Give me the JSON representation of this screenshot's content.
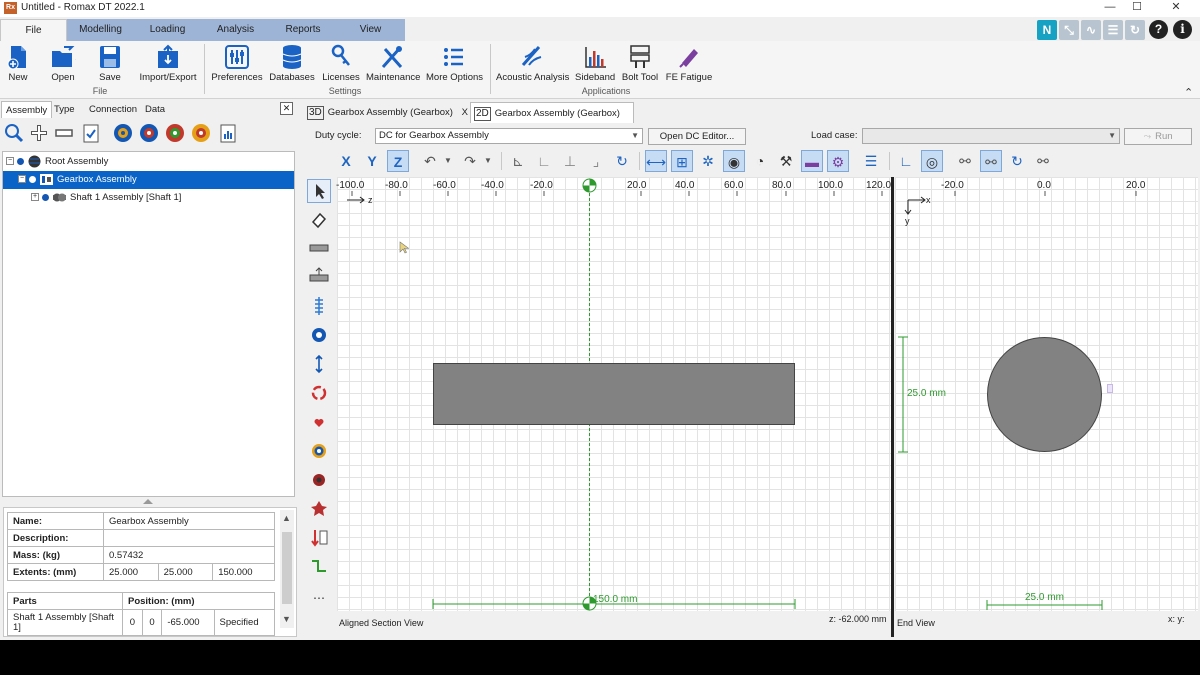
{
  "window": {
    "app_logo_text": "Rx",
    "title": "Untitled - Romax DT 2022.1",
    "min_glyph": "—",
    "max_glyph": "☐",
    "close_glyph": "✕"
  },
  "ribbon_tabs": [
    {
      "label": "File",
      "active": true
    },
    {
      "label": "Modelling"
    },
    {
      "label": "Loading"
    },
    {
      "label": "Analysis"
    },
    {
      "label": "Reports"
    },
    {
      "label": "View"
    }
  ],
  "ribbon": {
    "file_group": "File",
    "settings_group": "Settings",
    "applications_group": "Applications",
    "buttons": {
      "new": "New",
      "open": "Open",
      "save": "Save",
      "import_export": "Import/Export",
      "preferences": "Preferences",
      "databases": "Databases",
      "licenses": "Licenses",
      "maintenance": "Maintenance",
      "more_options": "More Options",
      "acoustic_analysis": "Acoustic Analysis",
      "sideband": "Sideband",
      "bolt_tool": "Bolt Tool",
      "fe_fatigue": "FE Fatigue"
    },
    "collapse_glyph": "⌃",
    "help_glyph": "?",
    "info_glyph": "i"
  },
  "left_panel": {
    "tabs": [
      "Assembly",
      "Type",
      "Connection",
      "Data"
    ],
    "close_glyph": "✕",
    "tree": [
      {
        "label": "Root Assembly",
        "expander": "−"
      },
      {
        "label": "Gearbox Assembly",
        "expander": "−",
        "selected": true
      },
      {
        "label": "Shaft 1 Assembly [Shaft 1]",
        "expander": "+"
      }
    ],
    "properties": {
      "name_label": "Name:",
      "name_value": "Gearbox Assembly",
      "desc_label": "Description:",
      "desc_value": "",
      "mass_label": "Mass: (kg)",
      "mass_value": "0.57432",
      "extents_label": "Extents: (mm)",
      "extents": [
        "25.000",
        "25.000",
        "150.000"
      ],
      "parts_header": "Parts",
      "position_header": "Position: (mm)",
      "part_name": "Shaft 1 Assembly [Shaft 1]",
      "part_position": [
        "0",
        "0",
        "-65.000"
      ],
      "part_status": "Specified"
    }
  },
  "documents": {
    "tabs": [
      {
        "badge": "3D",
        "label": "Gearbox Assembly (Gearbox)",
        "close": "X"
      },
      {
        "badge": "2D",
        "label": "Gearbox Assembly (Gearbox)",
        "close": "X",
        "active": true
      }
    ]
  },
  "duty_bar": {
    "duty_cycle_label": "Duty cycle:",
    "duty_cycle_value": "DC for Gearbox Assembly",
    "open_dc_editor": "Open DC Editor...",
    "load_case_label": "Load case:",
    "load_case_value": "",
    "run_label": "Run"
  },
  "view_toolbar": {
    "x_axis": "X",
    "y_axis": "Y",
    "z_axis": "Z"
  },
  "section_view": {
    "ticks": [
      "-100.0",
      "-80.0",
      "-60.0",
      "-40.0",
      "-20.0",
      "0.0",
      "20.0",
      "40.0",
      "60.0",
      "80.0",
      "100.0",
      "120.0"
    ],
    "axis_label": "z",
    "length_dim": "150.0 mm",
    "status_left": "Aligned Section View",
    "status_right": "z: -62.000 mm"
  },
  "end_view": {
    "ticks": [
      "-20.0",
      "0.0",
      "20.0"
    ],
    "axis_x": "x",
    "axis_y": "y",
    "height_dim": "25.0 mm",
    "width_dim": "25.0 mm",
    "status_left": "End View",
    "status_right": "x: y:"
  },
  "colors": {
    "ribbon_tab_bar": "#9db4d6",
    "selection": "#0a64c8",
    "shaft_fill": "#828282",
    "dimension_green": "#2e9a2e"
  }
}
